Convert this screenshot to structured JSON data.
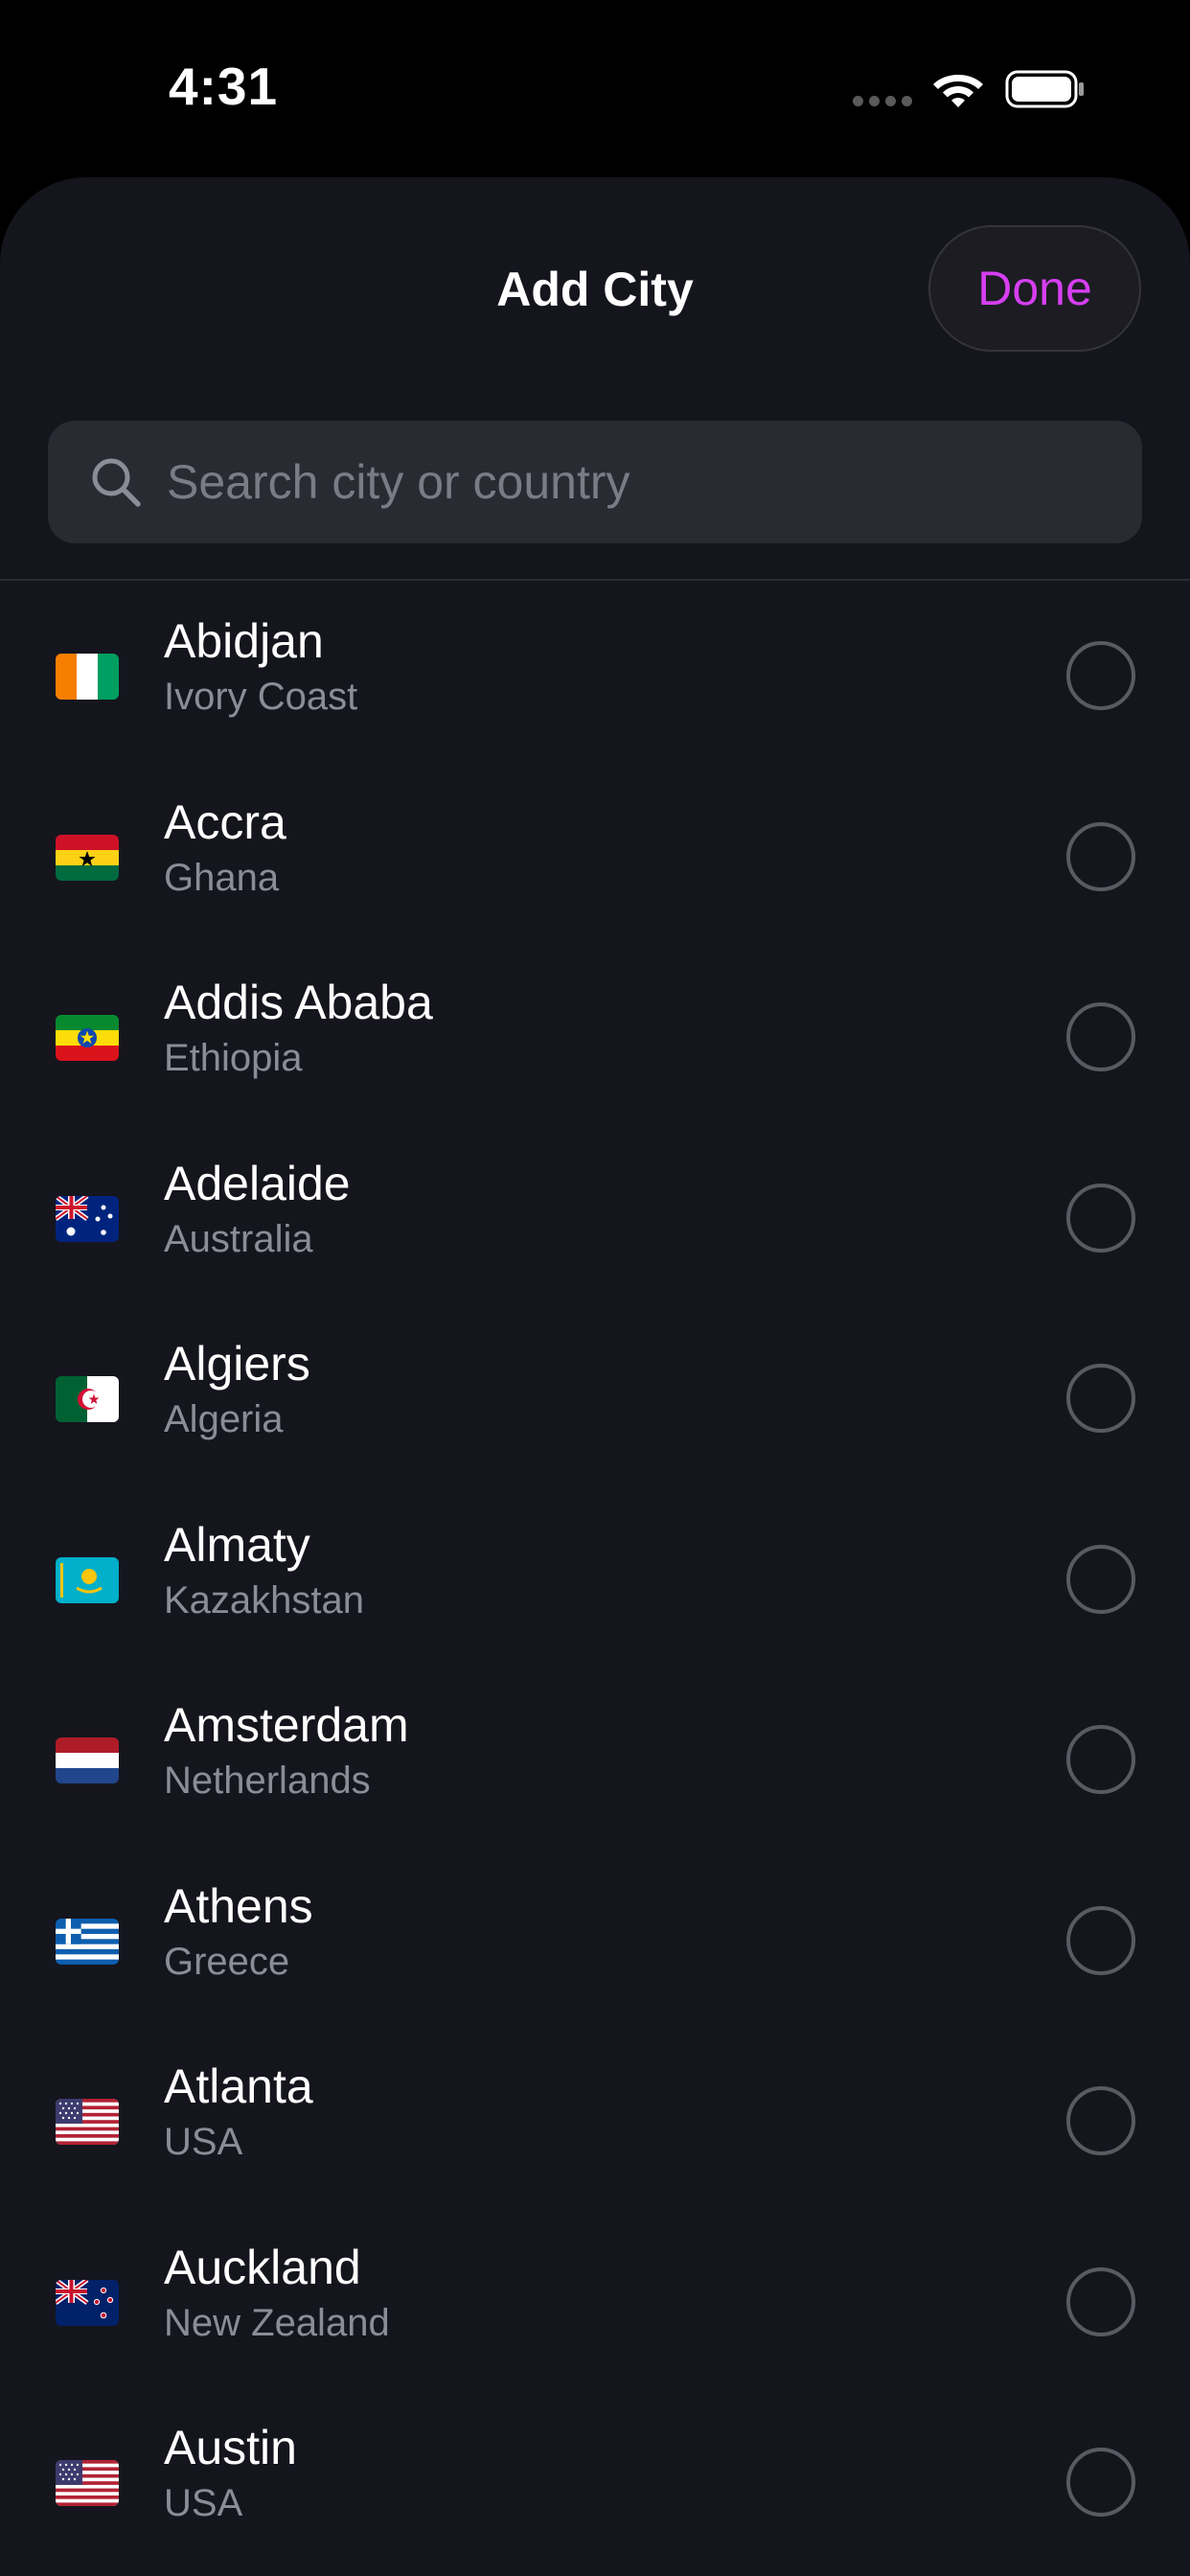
{
  "status_bar": {
    "time": "4:31",
    "icons": [
      "cellular-signal-icon",
      "wifi-icon",
      "battery-icon"
    ]
  },
  "header": {
    "title": "Add City",
    "done_label": "Done"
  },
  "search": {
    "placeholder": "Search city or country",
    "value": "",
    "icon": "search-icon"
  },
  "colors": {
    "accent": "#d63ff0",
    "sheet_background": "#15151e",
    "search_background": "#2a2a33",
    "secondary_text": "#8c8c96"
  },
  "cities": [
    {
      "city": "Abidjan",
      "country": "Ivory Coast",
      "flag": "flag-ivory-coast-icon",
      "selected": false
    },
    {
      "city": "Accra",
      "country": "Ghana",
      "flag": "flag-ghana-icon",
      "selected": false
    },
    {
      "city": "Addis Ababa",
      "country": "Ethiopia",
      "flag": "flag-ethiopia-icon",
      "selected": false
    },
    {
      "city": "Adelaide",
      "country": "Australia",
      "flag": "flag-australia-icon",
      "selected": false
    },
    {
      "city": "Algiers",
      "country": "Algeria",
      "flag": "flag-algeria-icon",
      "selected": false
    },
    {
      "city": "Almaty",
      "country": "Kazakhstan",
      "flag": "flag-kazakhstan-icon",
      "selected": false
    },
    {
      "city": "Amsterdam",
      "country": "Netherlands",
      "flag": "flag-netherlands-icon",
      "selected": false
    },
    {
      "city": "Athens",
      "country": "Greece",
      "flag": "flag-greece-icon",
      "selected": false
    },
    {
      "city": "Atlanta",
      "country": "USA",
      "flag": "flag-usa-icon",
      "selected": false
    },
    {
      "city": "Auckland",
      "country": "New Zealand",
      "flag": "flag-new-zealand-icon",
      "selected": false
    },
    {
      "city": "Austin",
      "country": "USA",
      "flag": "flag-usa-icon",
      "selected": false
    }
  ]
}
